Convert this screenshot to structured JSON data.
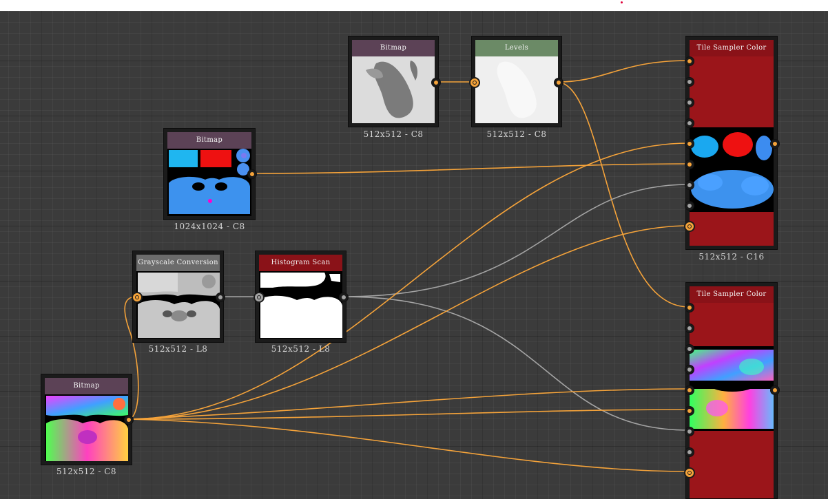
{
  "colors": {
    "background": "#3b3b3b",
    "wire_color": "#f5a33a",
    "wire_gray": "#a4a4a4",
    "header_bitmap": "#5c4256",
    "header_levels": "#6b8a66",
    "header_grayscale": "#6b6b6b",
    "header_histogram": "#8a1218",
    "header_tile_sampler": "#8a1218",
    "tile_sampler_body": "#9b151a"
  },
  "nodes": {
    "bitmap_top": {
      "title": "Bitmap",
      "caption": "512x512 - C8"
    },
    "levels": {
      "title": "Levels",
      "caption": "512x512 - C8"
    },
    "bitmap_mid": {
      "title": "Bitmap",
      "caption": "1024x1024 - C8"
    },
    "grayscale_conversion": {
      "title": "Grayscale Conversion",
      "caption": "512x512 - L8"
    },
    "histogram_scan": {
      "title": "Histogram Scan",
      "caption": "512x512 - L8"
    },
    "bitmap_bottom": {
      "title": "Bitmap",
      "caption": "512x512 - C8"
    },
    "tile_sampler_top": {
      "title": "Tile Sampler Color",
      "caption": "512x512 - C16"
    },
    "tile_sampler_bottom": {
      "title": "Tile Sampler Color",
      "caption": ""
    }
  }
}
